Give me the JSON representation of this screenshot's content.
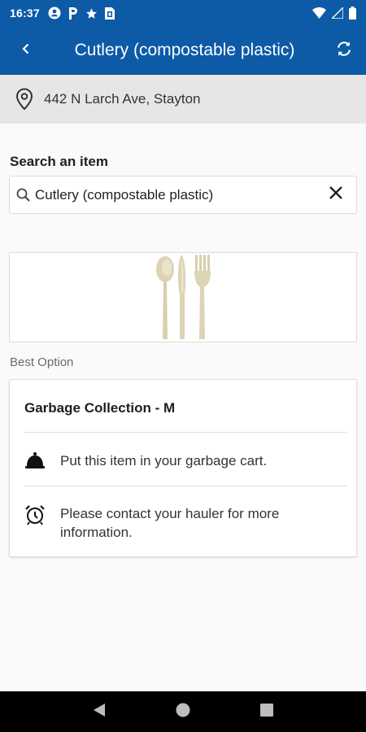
{
  "status_bar": {
    "time": "16:37",
    "left_icons": [
      "account-circle-icon",
      "parking-icon",
      "star-icon",
      "sim-card-icon"
    ],
    "right_icons": [
      "wifi-icon",
      "cell-signal-icon",
      "battery-icon"
    ]
  },
  "app_bar": {
    "title": "Cutlery (compostable plastic)",
    "back_icon": "chevron-left-icon",
    "refresh_icon": "refresh-icon"
  },
  "location": {
    "address": "442 N Larch Ave, Stayton",
    "icon": "map-pin-icon"
  },
  "search": {
    "label": "Search an item",
    "value": "Cutlery (compostable plastic)",
    "search_icon": "search-icon",
    "clear_icon": "close-icon"
  },
  "item_image": {
    "icon": "cutlery-image"
  },
  "best_option": {
    "label": "Best Option",
    "card_title": "Garbage Collection - M",
    "instructions": [
      {
        "icon": "bell-icon",
        "text": "Put this item in your garbage cart."
      },
      {
        "icon": "alarm-clock-icon",
        "text": "Please contact your hauler for more information."
      }
    ]
  },
  "nav_bar": {
    "buttons": [
      "back-triangle-icon",
      "home-circle-icon",
      "recents-square-icon"
    ]
  },
  "colors": {
    "primary": "#0d5aa7",
    "location_bg": "#e6e6e6",
    "page_bg": "#fafafa",
    "nav_bg": "#000000"
  }
}
